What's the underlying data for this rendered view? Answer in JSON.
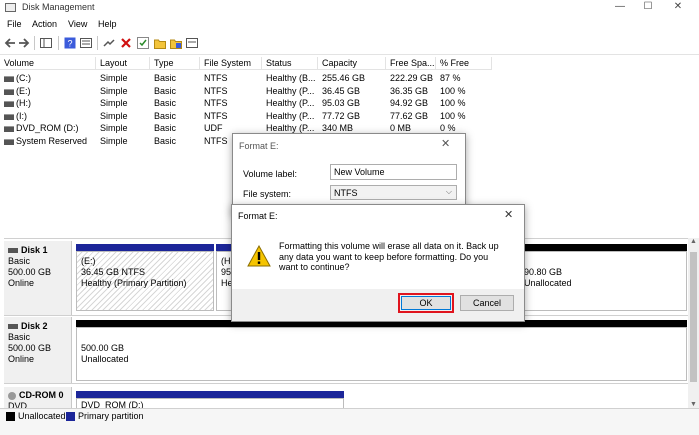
{
  "window": {
    "title": "Disk Management",
    "minimize": "—",
    "maximize": "☐",
    "close": "✕"
  },
  "menu": [
    "File",
    "Action",
    "View",
    "Help"
  ],
  "toolbar_icons": [
    "back-icon",
    "forward-icon",
    "console-tree-icon",
    "help-icon",
    "properties-icon",
    "connect-icon",
    "delete-icon",
    "check-icon",
    "folder-icon",
    "folder-open-icon",
    "list-icon"
  ],
  "table": {
    "headers": [
      "Volume",
      "Layout",
      "Type",
      "File System",
      "Status",
      "Capacity",
      "Free Spa...",
      "% Free"
    ],
    "rows": [
      [
        "(C:)",
        "Simple",
        "Basic",
        "NTFS",
        "Healthy (B...",
        "255.46 GB",
        "222.29 GB",
        "87 %"
      ],
      [
        "(E:)",
        "Simple",
        "Basic",
        "NTFS",
        "Healthy (P...",
        "36.45 GB",
        "36.35 GB",
        "100 %"
      ],
      [
        "(H:)",
        "Simple",
        "Basic",
        "NTFS",
        "Healthy (P...",
        "95.03 GB",
        "94.92 GB",
        "100 %"
      ],
      [
        "(I:)",
        "Simple",
        "Basic",
        "NTFS",
        "Healthy (P...",
        "77.72 GB",
        "77.62 GB",
        "100 %"
      ],
      [
        "DVD_ROM (D:)",
        "Simple",
        "Basic",
        "UDF",
        "Healthy (P...",
        "340 MB",
        "0 MB",
        "0 %"
      ],
      [
        "System Reserved",
        "Simple",
        "Basic",
        "NTFS",
        "",
        "",
        "",
        ""
      ]
    ]
  },
  "disks": {
    "disk1": {
      "name": "Disk 1",
      "type": "Basic",
      "size": "500.00 GB",
      "state": "Online",
      "part_e": {
        "name": "(E:)",
        "info": "36.45 GB NTFS",
        "status": "Healthy (Primary Partition)"
      },
      "part_h": {
        "name": "(H",
        "info": "95.",
        "status": "He"
      },
      "part_unalloc": {
        "size": "90.80 GB",
        "status": "Unallocated"
      }
    },
    "disk2": {
      "name": "Disk 2",
      "type": "Basic",
      "size": "500.00 GB",
      "state": "Online",
      "part": {
        "size": "500.00 GB",
        "status": "Unallocated"
      }
    },
    "cdrom": {
      "name": "CD-ROM 0",
      "type": "DVD",
      "part": "DVD_ROM (D:)"
    }
  },
  "legend": {
    "unallocated": "Unallocated",
    "primary": "Primary partition"
  },
  "format_dialog": {
    "title": "Format E:",
    "volume_label": "Volume label:",
    "volume_value": "New Volume",
    "file_system": "File system:",
    "file_system_value": "NTFS"
  },
  "confirm_dialog": {
    "title": "Format E:",
    "message": "Formatting this volume will erase all data on it. Back up any data you want to keep before formatting. Do you want to continue?",
    "ok": "OK",
    "cancel": "Cancel"
  },
  "colors": {
    "primary": "#1c2699",
    "unallocated": "#000000",
    "highlight": "#e0141e"
  }
}
